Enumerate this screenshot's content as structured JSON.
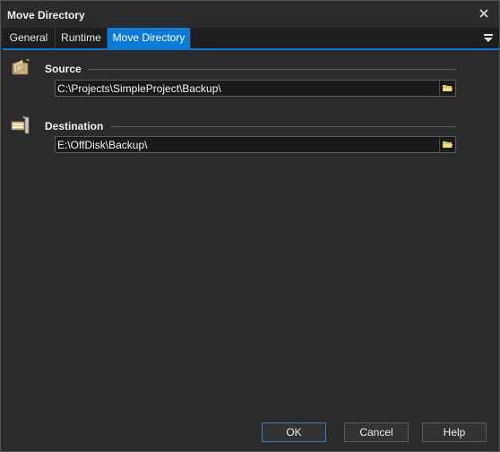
{
  "window": {
    "title": "Move Directory",
    "close_icon": "close-icon"
  },
  "tabs": [
    {
      "label": "General",
      "active": false
    },
    {
      "label": "Runtime",
      "active": false
    },
    {
      "label": "Move Directory",
      "active": true
    }
  ],
  "tab_menu_icon": "menu-icon",
  "source": {
    "label": "Source",
    "icon": "folder-icon",
    "value": "C:\\Projects\\SimpleProject\\Backup\\",
    "browse_icon": "folder-open-icon"
  },
  "destination": {
    "label": "Destination",
    "icon": "move-icon",
    "value": "E:\\OffDisk\\Backup\\",
    "browse_icon": "folder-open-icon"
  },
  "buttons": {
    "ok": "OK",
    "cancel": "Cancel",
    "help": "Help"
  },
  "colors": {
    "background": "#2b2b2b",
    "accent": "#0a7ad6",
    "field_bg": "#1a1a1a"
  }
}
